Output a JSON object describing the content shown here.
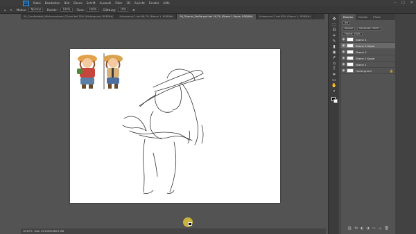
{
  "menubar": {
    "items": [
      "Datei",
      "Bearbeiten",
      "Bild",
      "Ebene",
      "Schrift",
      "Auswahl",
      "Filter",
      "3D",
      "Ansicht",
      "Fenster",
      "Hilfe"
    ],
    "win_controls": [
      "–",
      "□",
      "✕"
    ]
  },
  "options": {
    "modus_label": "Modus:",
    "modus_value": "Normal",
    "deckkraft_label": "Deckkr.:",
    "deckkraft_value": "100%",
    "fluss_label": "Fluss:",
    "fluss_value": "100%",
    "glaettung_label": "Glättung:",
    "glaettung_value": "10%"
  },
  "tabs": [
    {
      "label": "04_Comfortable_Wintercostume_03.psd bei 25% (Hintergrund, RGB/8#)"
    },
    {
      "label": "Unbenannt-1 bei 66,7% (Ebene 1, RGB/8#)"
    },
    {
      "label": "06_Tutorial_Profile.psd bei 16,7% (Ebene 1 Kopie, RGB/8#)",
      "active": true
    },
    {
      "label": "Unbenannt-2 bei 65% (Ebene 1, RGB/8#)"
    }
  ],
  "tools": [
    "✥",
    "⬚",
    "ʘ",
    "⌗",
    "✎",
    "▮",
    "◉",
    "✐",
    "⌂",
    "T",
    "➤",
    "▭",
    "✋",
    "⌕"
  ],
  "panel": {
    "tabs": [
      "Ebenen",
      "Kanäle",
      "Pfade"
    ],
    "kind_label": "Art",
    "blend_mode": "Normal",
    "opacity": "Deckkraft: 100%",
    "fill": "Fläche: 100%",
    "layers": [
      {
        "name": "Ebene 4",
        "selected": false,
        "locked": false
      },
      {
        "name": "Ebene 1 Kopie",
        "selected": true,
        "locked": false
      },
      {
        "name": "Ebene 3",
        "selected": false,
        "locked": false
      },
      {
        "name": "Ebene 2 Kopie",
        "selected": false,
        "locked": false
      },
      {
        "name": "Ebene 1",
        "selected": false,
        "locked": false
      },
      {
        "name": "Hintergrund",
        "selected": false,
        "locked": true
      }
    ],
    "footer_icons": [
      "⛓",
      "fx",
      "◐",
      "◑",
      "▭",
      "＋",
      "🗑"
    ]
  },
  "status": {
    "zoom": "16,67%",
    "doc": "Dok: 49,8 MB/186,5 MB"
  },
  "colors": {
    "foreground": "#000000",
    "background": "#ffffff",
    "accent": "#31a8ff"
  }
}
